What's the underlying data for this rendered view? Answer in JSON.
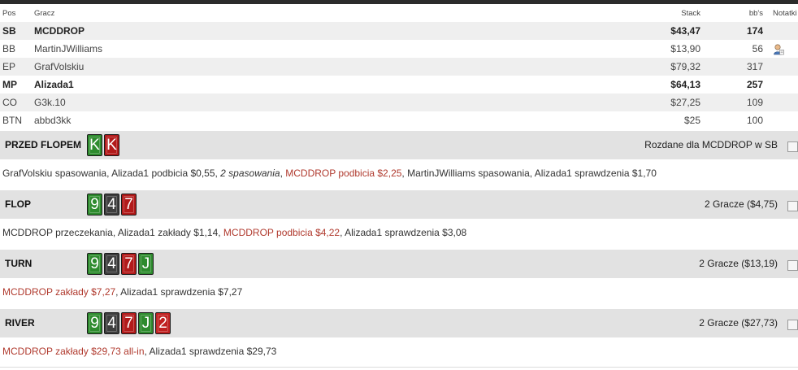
{
  "table": {
    "headers": {
      "pos": "Pos",
      "player": "Gracz",
      "stack": "Stack",
      "bbs": "bb's",
      "notes": "Notatki"
    },
    "rows": [
      {
        "pos": "SB",
        "player": "MCDDROP",
        "stack": "$43,47",
        "bbs": "174",
        "bold": true
      },
      {
        "pos": "BB",
        "player": "MartinJWilliams",
        "stack": "$13,90",
        "bbs": "56",
        "note_icon": "player-note-icon"
      },
      {
        "pos": "EP",
        "player": "GrafVolskiu",
        "stack": "$79,32",
        "bbs": "317"
      },
      {
        "pos": "MP",
        "player": "Alizada1",
        "stack": "$64,13",
        "bbs": "257",
        "bold": true
      },
      {
        "pos": "CO",
        "player": "G3k.10",
        "stack": "$27,25",
        "bbs": "109"
      },
      {
        "pos": "BTN",
        "player": "abbd3kk",
        "stack": "$25",
        "bbs": "100"
      }
    ]
  },
  "streets": [
    {
      "label": "PRZED FLOPEM",
      "cards": [
        {
          "rank": "K",
          "suit": "c"
        },
        {
          "rank": "K",
          "suit": "h"
        }
      ],
      "info": "Rozdane dla MCDDROP w SB",
      "actions": [
        {
          "text": "GrafVolskiu spasowania, Alizada1 podbicia $0,55, ",
          "style": ""
        },
        {
          "text": "2 spasowania",
          "style": "it"
        },
        {
          "text": ", ",
          "style": ""
        },
        {
          "text": "MCDDROP podbicia $2,25",
          "style": "hl"
        },
        {
          "text": ", MartinJWilliams spasowania, Alizada1 sprawdzenia $1,70",
          "style": ""
        }
      ]
    },
    {
      "label": "FLOP",
      "cards": [
        {
          "rank": "9",
          "suit": "c"
        },
        {
          "rank": "4",
          "suit": "s"
        },
        {
          "rank": "7",
          "suit": "h"
        }
      ],
      "info": "2 Gracze ($4,75)",
      "actions": [
        {
          "text": "MCDDROP przeczekania, Alizada1 zakłady $1,14, ",
          "style": ""
        },
        {
          "text": "MCDDROP podbicia $4,22",
          "style": "hl"
        },
        {
          "text": ", Alizada1 sprawdzenia $3,08",
          "style": ""
        }
      ]
    },
    {
      "label": "TURN",
      "cards": [
        {
          "rank": "9",
          "suit": "c"
        },
        {
          "rank": "4",
          "suit": "s"
        },
        {
          "rank": "7",
          "suit": "h"
        },
        {
          "rank": "J",
          "suit": "c"
        }
      ],
      "info": "2 Gracze ($13,19)",
      "actions": [
        {
          "text": "MCDDROP zakłady $7,27",
          "style": "hl"
        },
        {
          "text": ", Alizada1 sprawdzenia $7,27",
          "style": ""
        }
      ]
    },
    {
      "label": "RIVER",
      "cards": [
        {
          "rank": "9",
          "suit": "c"
        },
        {
          "rank": "4",
          "suit": "s"
        },
        {
          "rank": "7",
          "suit": "h"
        },
        {
          "rank": "J",
          "suit": "c"
        },
        {
          "rank": "2",
          "suit": "d"
        }
      ],
      "info": "2 Gracze ($27,73)",
      "actions": [
        {
          "text": "MCDDROP zakłady $29,73 all-in",
          "style": "hl"
        },
        {
          "text": ", Alizada1 sprawdzenia $29,73",
          "style": ""
        }
      ]
    }
  ]
}
